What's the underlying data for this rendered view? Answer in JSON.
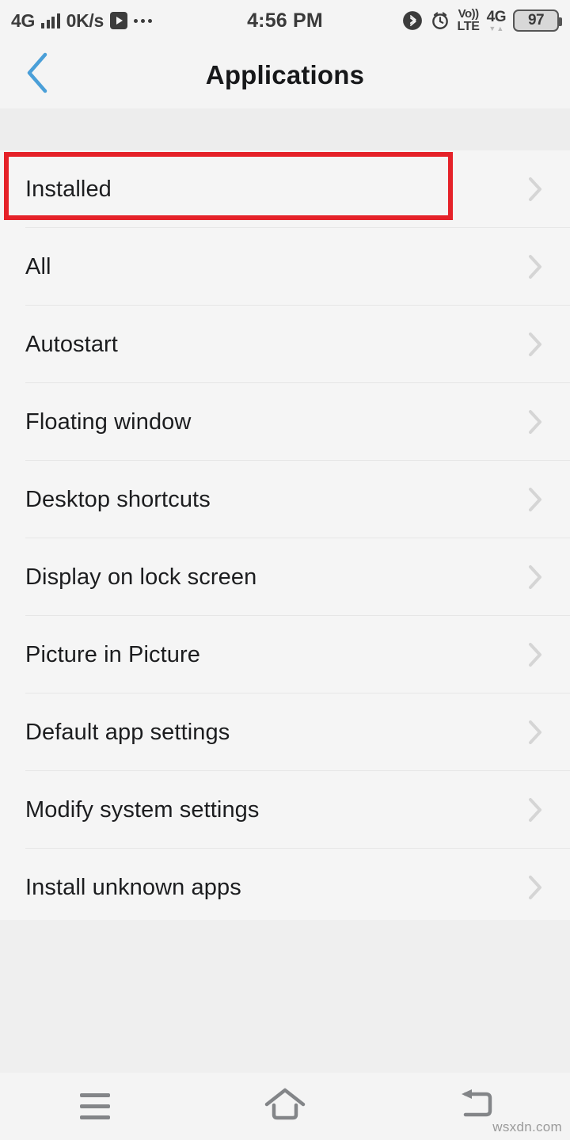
{
  "status_bar": {
    "network_label": "4G",
    "signal_icon": "signal-bars-icon",
    "data_rate": "0K/s",
    "play_icon": "play-icon",
    "overflow_icon": "more-dots-icon",
    "time": "4:56 PM",
    "bluetooth_icon": "bluetooth-icon",
    "alarm_icon": "alarm-clock-icon",
    "volte_top": "Vo))",
    "volte_bottom": "LTE",
    "mobile_network": "4G",
    "data_arrow_down": "▼",
    "data_arrow_up": "▲",
    "battery_level": "97",
    "battery_icon": "battery-icon"
  },
  "header": {
    "back_icon": "back-chevron-icon",
    "title": "Applications",
    "accent_color": "#4a9fd8"
  },
  "list": {
    "chevron_icon": "chevron-right-icon",
    "items": [
      {
        "label": "Installed",
        "highlighted": true
      },
      {
        "label": "All",
        "highlighted": false
      },
      {
        "label": "Autostart",
        "highlighted": false
      },
      {
        "label": "Floating window",
        "highlighted": false
      },
      {
        "label": "Desktop shortcuts",
        "highlighted": false
      },
      {
        "label": "Display on lock screen",
        "highlighted": false
      },
      {
        "label": "Picture in Picture",
        "highlighted": false
      },
      {
        "label": "Default app settings",
        "highlighted": false
      },
      {
        "label": "Modify system settings",
        "highlighted": false
      },
      {
        "label": "Install unknown apps",
        "highlighted": false
      }
    ]
  },
  "highlight": {
    "target_label": "Installed",
    "color": "#e52229"
  },
  "nav_bar": {
    "menu_icon": "menu-hamburger-icon",
    "home_icon": "home-icon",
    "back_icon": "back-return-icon"
  },
  "watermark": {
    "text": "wsxdn.com"
  }
}
